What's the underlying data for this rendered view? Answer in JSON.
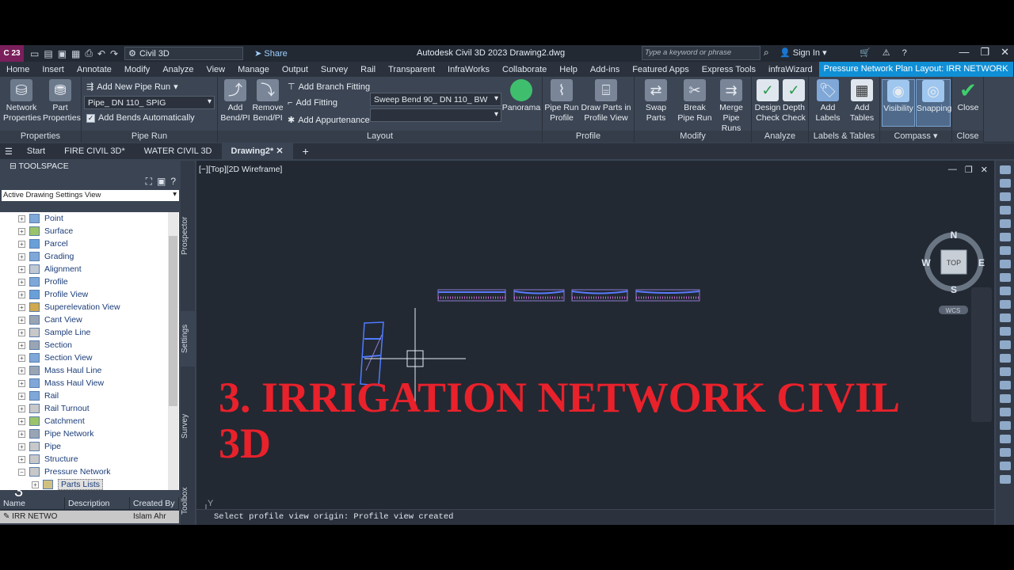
{
  "titlebar": {
    "app_badge": "C 23",
    "workspace": "Civil 3D",
    "share": "Share",
    "title": "Autodesk Civil 3D 2023    Drawing2.dwg",
    "search_placeholder": "Type a keyword or phrase",
    "signin": "Sign In"
  },
  "menu": {
    "items": [
      "Home",
      "Insert",
      "Annotate",
      "Modify",
      "Analyze",
      "View",
      "Manage",
      "Output",
      "Survey",
      "Rail",
      "Transparent",
      "InfraWorks",
      "Collaborate",
      "Help",
      "Add-ins",
      "Featured Apps",
      "Express Tools",
      "infraWizard"
    ],
    "context_tab": "Pressure Network Plan Layout: IRR NETWORK"
  },
  "ribbon": {
    "properties": {
      "title": "Properties",
      "network_properties": "Network Properties",
      "part_properties": "Part Properties"
    },
    "piperun": {
      "title": "Pipe Run",
      "add_pipe_run": "Add New Pipe Run",
      "pipe_select": "Pipe_ DN 110_ SPIG",
      "add_bends": "Add Bends Automatically"
    },
    "layout": {
      "title": "Layout",
      "add_bend": "Add Bend/PI",
      "remove_bend": "Remove Bend/PI",
      "add_branch": "Add Branch Fitting",
      "add_fitting": "Add Fitting",
      "add_appurtenance": "Add Appurtenance",
      "fitting_select": "Sweep Bend 90_ DN 110_ BW",
      "panorama": "Panorama"
    },
    "profile": {
      "title": "Profile",
      "pipe_run_profile": "Pipe Run Profile",
      "draw_parts": "Draw Parts in Profile View"
    },
    "modify": {
      "title": "Modify",
      "swap": "Swap Parts",
      "break": "Break Pipe Run",
      "merge": "Merge Pipe Runs"
    },
    "analyze": {
      "title": "Analyze",
      "design": "Design Check",
      "depth": "Depth Check"
    },
    "labels": {
      "title": "Labels & Tables",
      "add_labels": "Add Labels",
      "add_tables": "Add Tables"
    },
    "compass": {
      "title": "Compass",
      "visibility": "Visibility",
      "snapping": "Snapping"
    },
    "close": {
      "title": "Close",
      "close": "Close"
    }
  },
  "doctabs": [
    "Start",
    "FIRE CIVIL 3D*",
    "WATER CIVIL 3D",
    "Drawing2*"
  ],
  "toolspace": {
    "title": "TOOLSPACE",
    "view": "Active Drawing Settings View",
    "items": [
      "Point",
      "Surface",
      "Parcel",
      "Grading",
      "Alignment",
      "Profile",
      "Profile View",
      "Superelevation View",
      "Cant View",
      "Sample Line",
      "Section",
      "Section View",
      "Mass Haul Line",
      "Mass Haul View",
      "Rail",
      "Rail Turnout",
      "Catchment",
      "Pipe Network",
      "Pipe",
      "Structure",
      "Pressure Network"
    ],
    "subitem": "Parts Lists",
    "side_tabs": [
      "Prospector",
      "Settings",
      "Survey",
      "Toolbox"
    ],
    "list_headers": [
      "Name",
      "Description",
      "Created By"
    ],
    "list_row": [
      "IRR NETWO",
      "",
      "Islam Ahr"
    ]
  },
  "viewport": {
    "label": "[−][Top][2D Wireframe]",
    "compass": {
      "n": "N",
      "s": "S",
      "e": "E",
      "w": "W",
      "top": "TOP",
      "wcs": "WCS"
    },
    "overlay_line1": "3. IRRIGATION NETWORK CIVIL",
    "overlay_line2": "3D"
  },
  "command": "Select profile view origin: Profile view created",
  "corner_number": "3",
  "colors": {
    "accent": "#0f8fd6",
    "overlay_red": "#e8212b",
    "viewport_bg": "#222933"
  }
}
